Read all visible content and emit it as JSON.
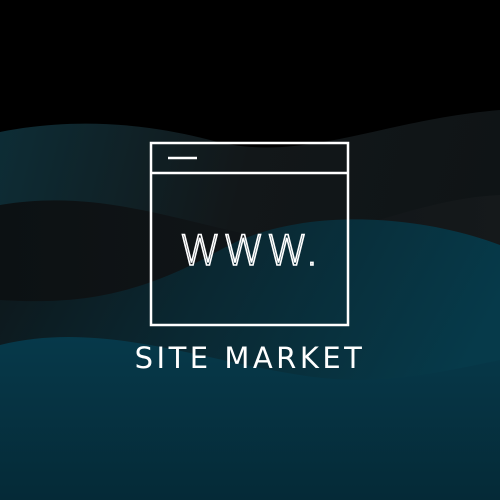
{
  "logo": {
    "url_mark": "WWW.",
    "brand_name": "SITE MARKET"
  },
  "colors": {
    "background": "#000000",
    "wave_dark": "#0e1214",
    "wave_mid": "#111619",
    "wave_teal": "#06394a",
    "foreground": "#ffffff"
  },
  "icons": {
    "browser_window": "browser-window-icon"
  }
}
